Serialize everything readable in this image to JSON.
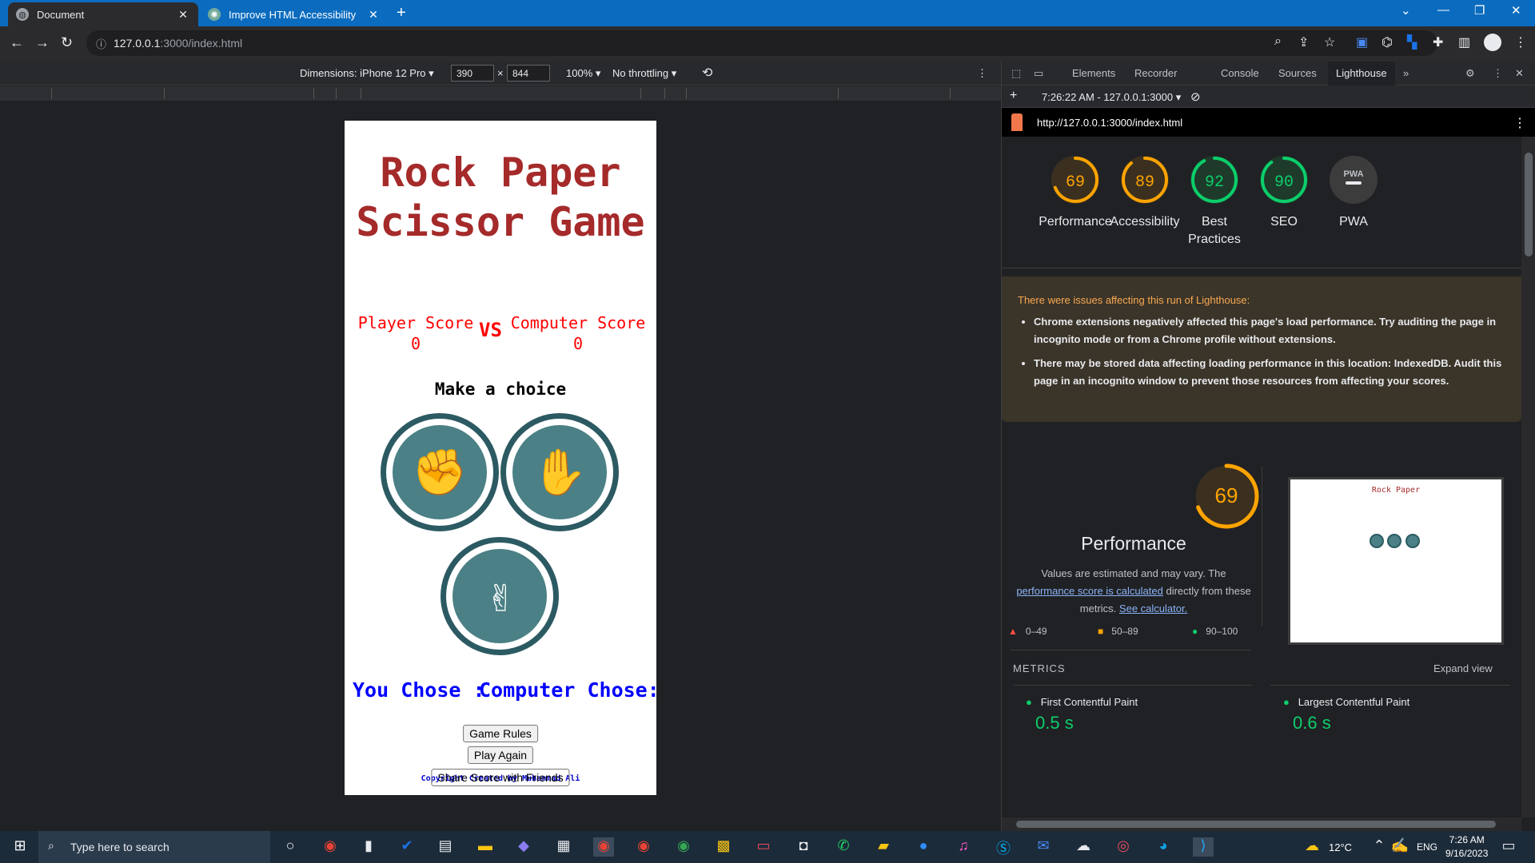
{
  "browser": {
    "tabs": [
      {
        "title": "Document",
        "active": true
      },
      {
        "title": "Improve HTML Accessibility",
        "active": false
      }
    ],
    "url_host": "127.0.0.1",
    "url_path": ":3000/index.html"
  },
  "device_toolbar": {
    "dimensions": "Dimensions: iPhone 12 Pro",
    "width": "390",
    "height": "844",
    "zoom": "100%",
    "throttling": "No throttling"
  },
  "game": {
    "title_line1": "Rock Paper",
    "title_line2": "Scissor Game",
    "player_score_label": "Player Score",
    "player_score": "0",
    "vs": "VS",
    "computer_score_label": "Computer Score",
    "computer_score": "0",
    "make_choice": "Make a choice",
    "you_chose": "You Chose :",
    "computer_chose": "Computer Chose:",
    "buttons": {
      "rules": "Game Rules",
      "play_again": "Play Again",
      "share": "Share Score with Friends"
    },
    "copyright": "Copyright Created by Muhammad Ali"
  },
  "devtools": {
    "tabs": [
      "Elements",
      "Recorder",
      "Console",
      "Sources",
      "Lighthouse"
    ],
    "report_time": "7:26:22 AM - 127.0.0.1:3000",
    "report_url": "http://127.0.0.1:3000/index.html",
    "scores": [
      {
        "label": "Performance",
        "value": "69",
        "color": "#ffa400",
        "fraction": 0.69
      },
      {
        "label": "Accessibility",
        "value": "89",
        "color": "#ffa400",
        "fraction": 0.89
      },
      {
        "label": "Best Practices",
        "value": "92",
        "color": "#0cce6b",
        "fraction": 0.92
      },
      {
        "label": "SEO",
        "value": "90",
        "color": "#0cce6b",
        "fraction": 0.9
      },
      {
        "label": "PWA",
        "value": "PWA",
        "color": "#9aa0a6",
        "fraction": 0
      }
    ],
    "warning_title": "There were issues affecting this run of Lighthouse:",
    "warnings": [
      "Chrome extensions negatively affected this page's load performance. Try auditing the page in incognito mode or from a Chrome profile without extensions.",
      "There may be stored data affecting loading performance in this location: IndexedDB. Audit this page in an incognito window to prevent those resources from affecting your scores."
    ],
    "perf_score": "69",
    "perf_title": "Performance",
    "perf_desc_1": "Values are estimated and may vary. The",
    "perf_link_1": "performance score is calculated",
    "perf_desc_2": "directly from these",
    "perf_desc_3": "metrics.",
    "perf_link_2": "See calculator.",
    "legend": [
      "0–49",
      "50–89",
      "90–100"
    ],
    "metrics_heading": "METRICS",
    "expand_view": "Expand view",
    "metrics": [
      {
        "name": "First Contentful Paint",
        "value": "0.5 s"
      },
      {
        "name": "Largest Contentful Paint",
        "value": "0.6 s"
      }
    ]
  },
  "taskbar": {
    "search_placeholder": "Type here to search",
    "weather": "12°C",
    "lang": "ENG",
    "time": "7:26 AM",
    "date": "9/16/2023"
  }
}
